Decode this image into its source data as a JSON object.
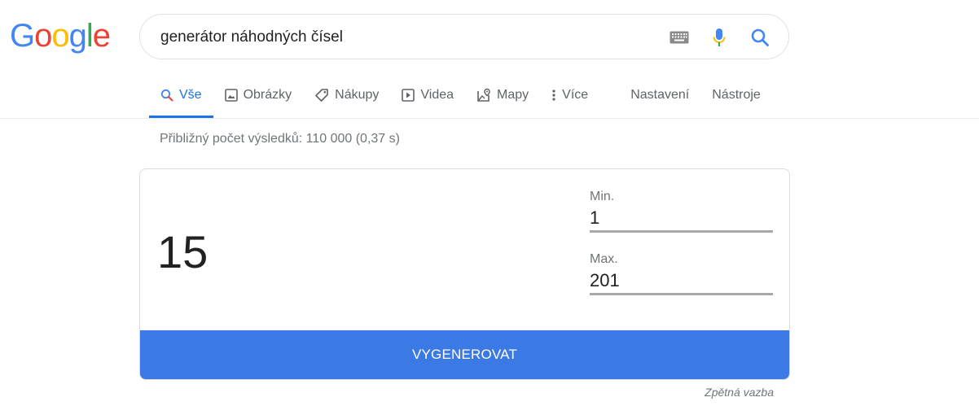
{
  "logo": {
    "letters": [
      "G",
      "o",
      "o",
      "g",
      "l",
      "e"
    ],
    "colors": [
      "#4285F4",
      "#EA4335",
      "#FBBC05",
      "#4285F4",
      "#34A853",
      "#EA4335"
    ]
  },
  "search": {
    "value": "generátor náhodných čísel",
    "icons": [
      "keyboard-icon",
      "microphone-icon",
      "search-icon"
    ]
  },
  "tabs": [
    {
      "label": "Vše",
      "icon": "search-icon",
      "active": true
    },
    {
      "label": "Obrázky",
      "icon": "image-icon",
      "active": false
    },
    {
      "label": "Nákupy",
      "icon": "tag-icon",
      "active": false
    },
    {
      "label": "Videa",
      "icon": "play-icon",
      "active": false
    },
    {
      "label": "Mapy",
      "icon": "map-pin-icon",
      "active": false
    },
    {
      "label": "Více",
      "icon": "more-vert-icon",
      "active": false
    }
  ],
  "tools": {
    "settings_label": "Nastavení",
    "tools_label": "Nástroje"
  },
  "stats": "Přibližný počet výsledků: 110 000 (0,37 s)",
  "generator": {
    "result": "15",
    "min_label": "Min.",
    "min_value": "1",
    "max_label": "Max.",
    "max_value": "201",
    "button_label": "VYGENEROVAT",
    "button_color": "#3b7ae4"
  },
  "feedback_label": "Zpětná vazba",
  "colors": {
    "accent": "#1a73e8",
    "muted_text": "#70757a"
  }
}
